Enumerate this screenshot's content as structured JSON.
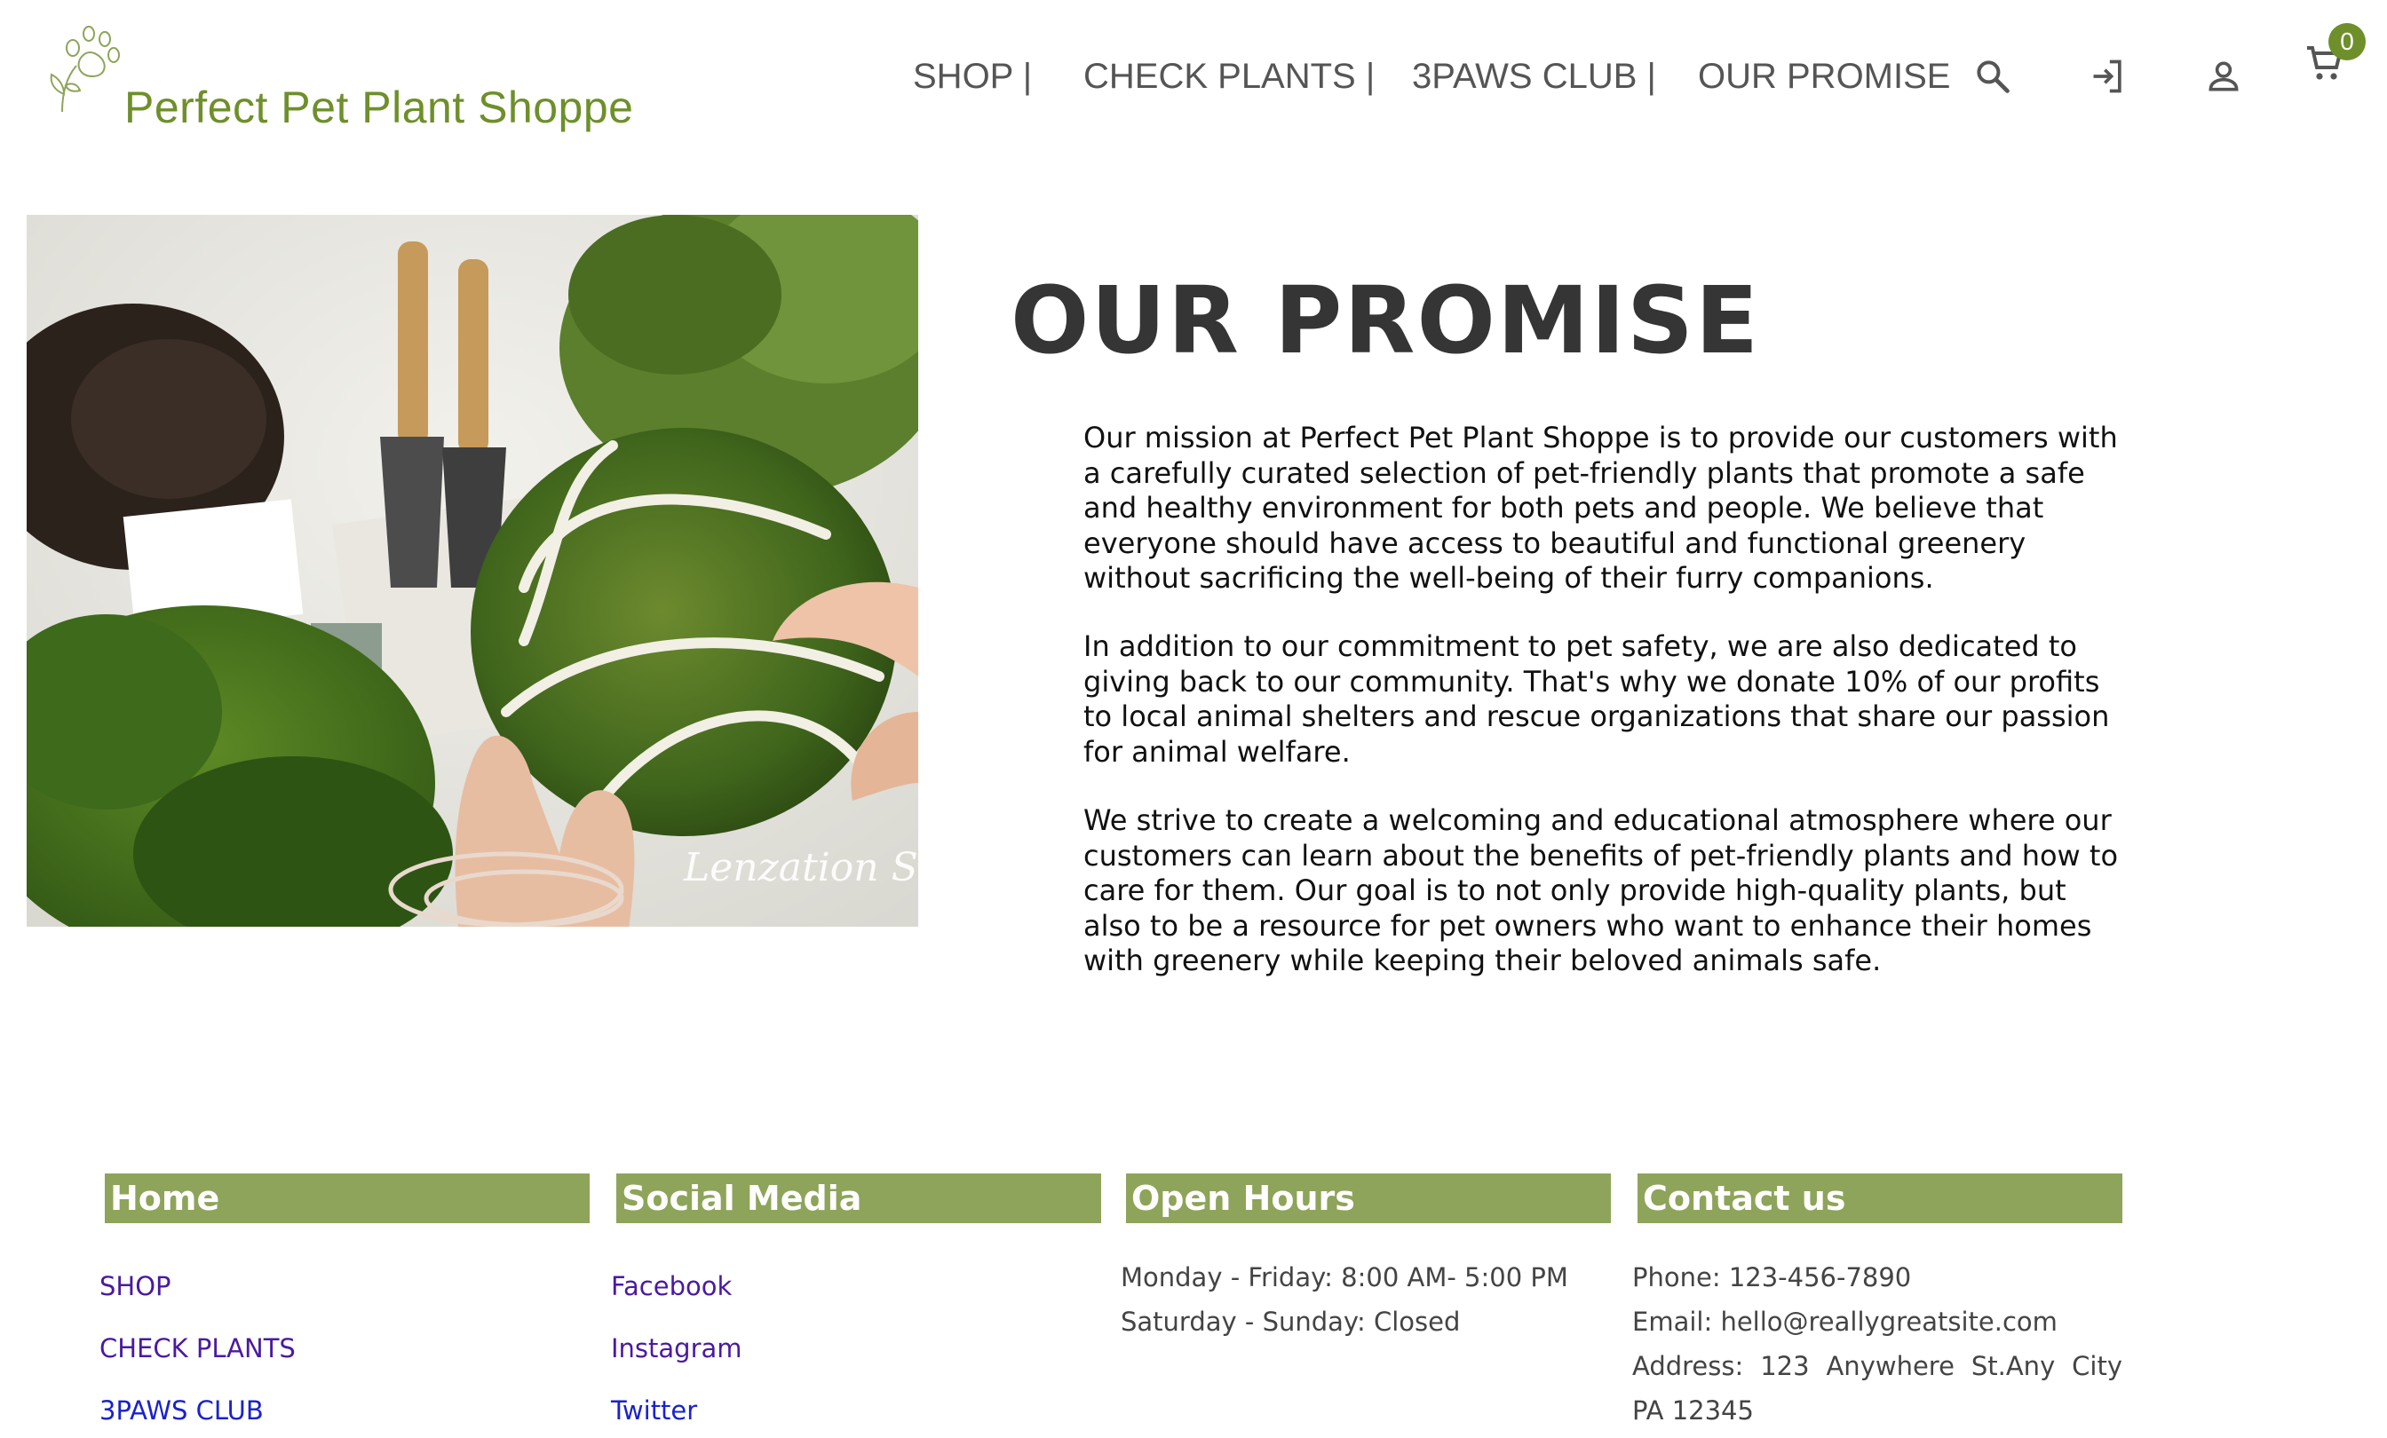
{
  "brand": {
    "name": "Perfect Pet Plant Shoppe",
    "color": "#6e8f2a"
  },
  "nav": {
    "items": [
      {
        "label": "SHOP |"
      },
      {
        "label": "CHECK PLANTS |"
      },
      {
        "label": "3PAWS CLUB |"
      },
      {
        "label": "OUR PROMISE"
      }
    ],
    "icons": [
      "search-icon",
      "login-icon",
      "account-icon",
      "cart-icon"
    ],
    "cart_count": "0"
  },
  "hero": {
    "watermark": "Lenzation Studio"
  },
  "main": {
    "title": "OUR PROMISE",
    "paragraphs": [
      "Our mission at Perfect Pet Plant Shoppe is to provide our customers with a carefully curated selection of pet-friendly plants that promote a safe and healthy environment for both pets and people. We believe that everyone should have access to beautiful and functional greenery without sacrificing the well-being of their furry companions.",
      "In addition to our commitment to pet safety, we are also dedicated to giving back to our community. That's why we donate 10% of our profits to local animal shelters and rescue organizations that share our passion for animal welfare.",
      "We strive to create a welcoming and educational atmosphere where our customers can learn about the benefits of pet-friendly plants and how to care for them. Our goal is to not only provide high-quality plants, but also to be a resource for pet owners who want to enhance their homes with greenery while keeping their beloved animals safe."
    ]
  },
  "footer": {
    "home": {
      "heading": "Home",
      "links": [
        "SHOP",
        "CHECK PLANTS",
        "3PAWS CLUB"
      ]
    },
    "social": {
      "heading": "Social Media",
      "links": [
        "Facebook",
        "Instagram",
        "Twitter"
      ]
    },
    "hours": {
      "heading": "Open Hours",
      "weekday": "Monday - Friday: 8:00 AM- 5:00 PM",
      "weekend": "Saturday - Sunday: Closed"
    },
    "contact": {
      "heading": "Contact us",
      "phone": "Phone: 123-456-7890",
      "email": "Email: hello@reallygreatsite.com",
      "address": "Address: 123 Anywhere St.Any City PA 12345"
    },
    "heading_color": "#8ea45a"
  }
}
